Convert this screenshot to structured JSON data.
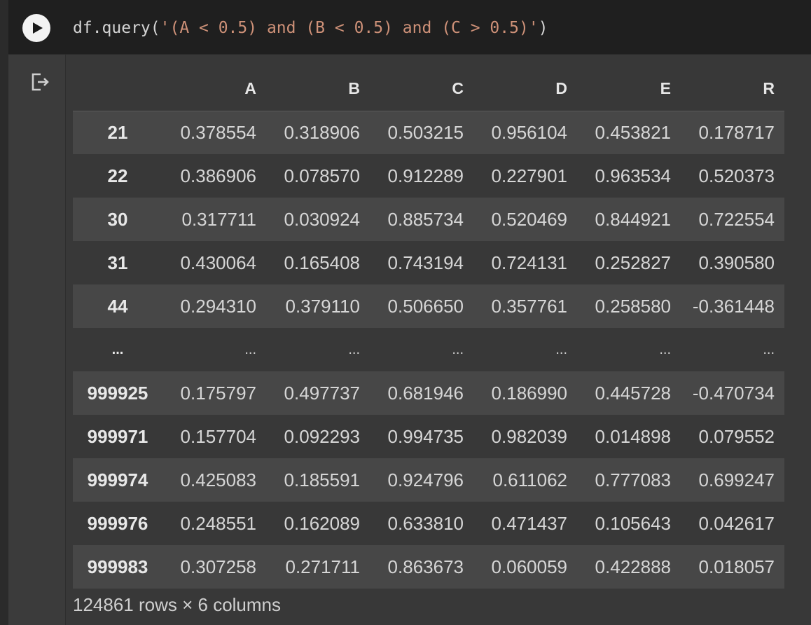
{
  "code_cell": {
    "code_prefix": "df.query(",
    "code_string": "'(A < 0.5) and (B < 0.5) and (C > 0.5)'",
    "code_suffix": ")"
  },
  "icons": {
    "run": "play-icon",
    "output": "output-redirect-icon"
  },
  "dataframe": {
    "columns": [
      "A",
      "B",
      "C",
      "D",
      "E",
      "R"
    ],
    "rows": [
      {
        "index": "21",
        "values": [
          "0.378554",
          "0.318906",
          "0.503215",
          "0.956104",
          "0.453821",
          "0.178717"
        ]
      },
      {
        "index": "22",
        "values": [
          "0.386906",
          "0.078570",
          "0.912289",
          "0.227901",
          "0.963534",
          "0.520373"
        ]
      },
      {
        "index": "30",
        "values": [
          "0.317711",
          "0.030924",
          "0.885734",
          "0.520469",
          "0.844921",
          "0.722554"
        ]
      },
      {
        "index": "31",
        "values": [
          "0.430064",
          "0.165408",
          "0.743194",
          "0.724131",
          "0.252827",
          "0.390580"
        ]
      },
      {
        "index": "44",
        "values": [
          "0.294310",
          "0.379110",
          "0.506650",
          "0.357761",
          "0.258580",
          "-0.361448"
        ]
      },
      {
        "index": "...",
        "values": [
          "...",
          "...",
          "...",
          "...",
          "...",
          "..."
        ]
      },
      {
        "index": "999925",
        "values": [
          "0.175797",
          "0.497737",
          "0.681946",
          "0.186990",
          "0.445728",
          "-0.470734"
        ]
      },
      {
        "index": "999971",
        "values": [
          "0.157704",
          "0.092293",
          "0.994735",
          "0.982039",
          "0.014898",
          "0.079552"
        ]
      },
      {
        "index": "999974",
        "values": [
          "0.425083",
          "0.185591",
          "0.924796",
          "0.611062",
          "0.777083",
          "0.699247"
        ]
      },
      {
        "index": "999976",
        "values": [
          "0.248551",
          "0.162089",
          "0.633810",
          "0.471437",
          "0.105643",
          "0.042617"
        ]
      },
      {
        "index": "999983",
        "values": [
          "0.307258",
          "0.271711",
          "0.863673",
          "0.060059",
          "0.422888",
          "0.018057"
        ]
      }
    ],
    "shape_text": "124861 rows × 6 columns"
  },
  "colors": {
    "background": "#383838",
    "code_background": "#1f1f1f",
    "string_token": "#ce9178",
    "striped_row": "#474747"
  }
}
